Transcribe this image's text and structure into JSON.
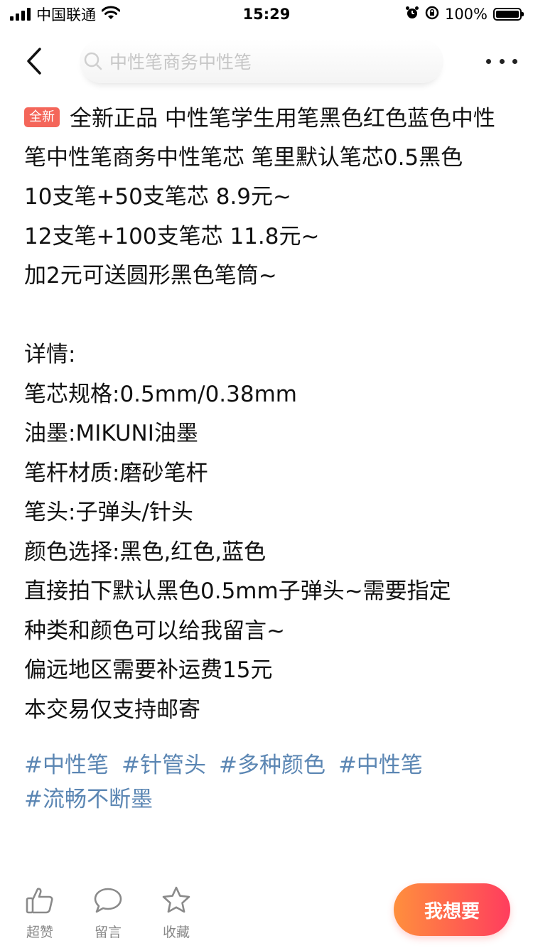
{
  "status_bar": {
    "carrier": "中国联通",
    "time": "15:29",
    "battery": "100%",
    "battery_level": 1.0
  },
  "nav": {
    "search_placeholder": "中性笔商务中性笔"
  },
  "post": {
    "badge": "全新",
    "title_text": "全新正品 中性笔学生用笔黑色红色蓝色中性笔中性笔商务中性笔芯 笔里默认笔芯0.5黑色",
    "lines": [
      "10支笔+50支笔芯 8.9元~",
      "12支笔+100支笔芯 11.8元~",
      "加2元可送圆形黑色笔筒~",
      "",
      "详情:",
      "笔芯规格:0.5mm/0.38mm",
      "油墨:MIKUNI油墨",
      "笔杆材质:磨砂笔杆",
      "笔头:子弹头/针头",
      "颜色选择:黑色,红色,蓝色",
      "直接拍下默认黑色0.5mm子弹头~需要指定",
      "种类和颜色可以给我留言~",
      "偏远地区需要补运费15元",
      "本交易仅支持邮寄"
    ],
    "tags": [
      "#中性笔",
      "#针管头",
      "#多种颜色",
      "#中性笔",
      "#流畅不断墨"
    ]
  },
  "bottom_bar": {
    "like_label": "超赞",
    "comment_label": "留言",
    "favorite_label": "收藏",
    "want_label": "我想要"
  },
  "colors": {
    "badge_bg": "#f4665a",
    "tag_text": "#5b86b3",
    "want_gradient_start": "#ff8f3d",
    "want_gradient_end": "#ff3d5e"
  },
  "icons": {
    "back": "chevron-left-icon",
    "search": "search-icon",
    "more": "more-dots-icon",
    "like": "thumbs-up-icon",
    "comment": "speech-bubble-icon",
    "favorite": "star-icon",
    "wifi": "wifi-icon",
    "alarm": "alarm-clock-icon",
    "rotation_lock": "rotation-lock-icon"
  }
}
